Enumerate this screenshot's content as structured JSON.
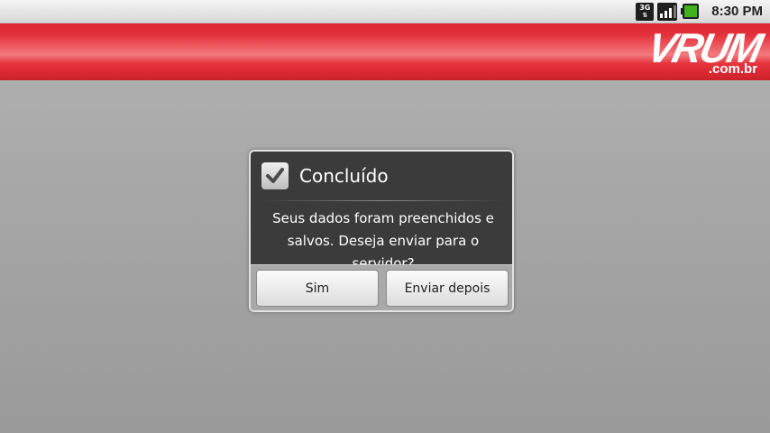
{
  "status_bar": {
    "network_type": "3G",
    "time": "8:30 PM",
    "icons": [
      "3g-data-icon",
      "signal-icon",
      "battery-icon"
    ]
  },
  "header": {
    "logo_word": "VRUM",
    "logo_tld": ".com.br",
    "color": "#e0313a"
  },
  "dialog": {
    "title": "Concluído",
    "title_icon": "checkbox-checked-icon",
    "message": "Seus dados foram preenchidos e salvos. Deseja enviar para o servidor?",
    "buttons": {
      "positive": "Sim",
      "negative": "Enviar depois"
    }
  }
}
